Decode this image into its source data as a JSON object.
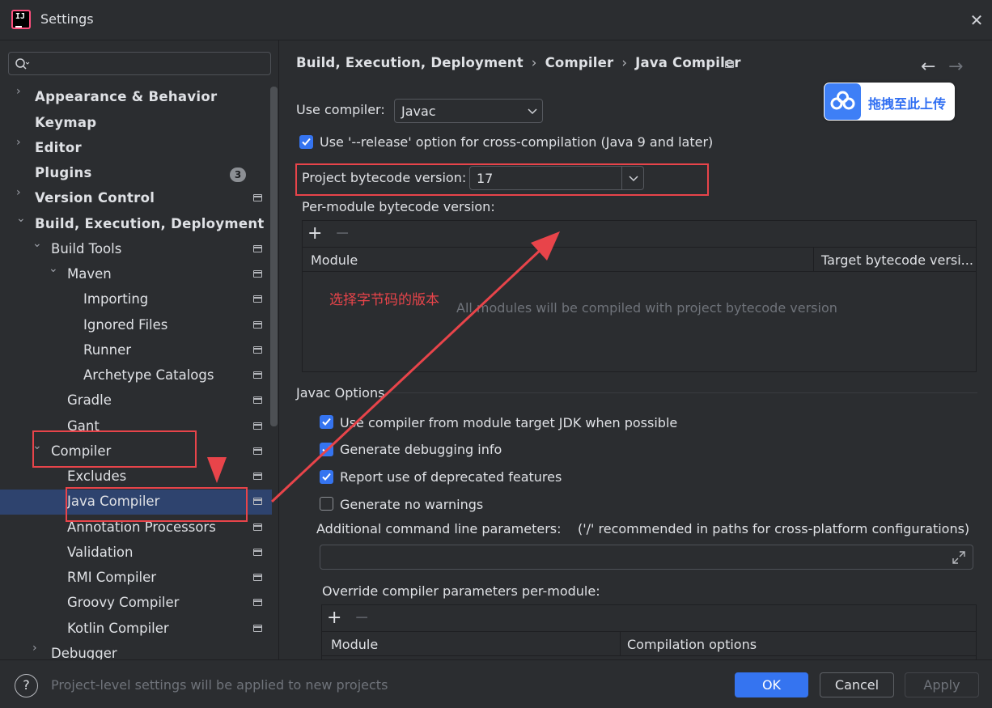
{
  "window": {
    "title": "Settings"
  },
  "sidebar": {
    "search_placeholder": "",
    "items": [
      {
        "label": "Appearance & Behavior"
      },
      {
        "label": "Keymap"
      },
      {
        "label": "Editor"
      },
      {
        "label": "Plugins",
        "badge": "3"
      },
      {
        "label": "Version Control"
      },
      {
        "label": "Build, Execution, Deployment"
      },
      {
        "label": "Build Tools"
      },
      {
        "label": "Maven"
      },
      {
        "label": "Importing"
      },
      {
        "label": "Ignored Files"
      },
      {
        "label": "Runner"
      },
      {
        "label": "Archetype Catalogs"
      },
      {
        "label": "Gradle"
      },
      {
        "label": "Gant"
      },
      {
        "label": "Compiler"
      },
      {
        "label": "Excludes"
      },
      {
        "label": "Java Compiler",
        "selected": true
      },
      {
        "label": "Annotation Processors"
      },
      {
        "label": "Validation"
      },
      {
        "label": "RMI Compiler"
      },
      {
        "label": "Groovy Compiler"
      },
      {
        "label": "Kotlin Compiler"
      },
      {
        "label": "Debugger"
      }
    ]
  },
  "breadcrumb": [
    "Build, Execution, Deployment",
    "Compiler",
    "Java Compiler"
  ],
  "upload_widget": {
    "label": "拖拽至此上传"
  },
  "main": {
    "use_compiler_label": "Use compiler:",
    "use_compiler_value": "Javac",
    "release_option_label": "Use '--release' option for cross-compilation (Java 9 and later)",
    "release_option_checked": true,
    "project_bytecode_label": "Project bytecode version:",
    "project_bytecode_value": "17",
    "per_module_label": "Per-module bytecode version:",
    "per_module_table": {
      "columns": [
        "Module",
        "Target bytecode versi..."
      ],
      "empty_text": "All modules will be compiled with project bytecode version"
    },
    "javac_section_title": "Javac Options",
    "javac_options": [
      {
        "label": "Use compiler from module target JDK when possible",
        "checked": true
      },
      {
        "label": "Generate debugging info",
        "checked": true
      },
      {
        "label": "Report use of deprecated features",
        "checked": true
      },
      {
        "label": "Generate no warnings",
        "checked": false
      }
    ],
    "additional_params_label": "Additional command line parameters:",
    "additional_params_hint": "('/' recommended in paths for cross-platform configurations)",
    "additional_params_value": "",
    "override_label": "Override compiler parameters per-module:",
    "override_table": {
      "columns": [
        "Module",
        "Compilation options"
      ]
    }
  },
  "annotation": {
    "text": "选择字节码的版本",
    "color": "#e8444a"
  },
  "footer": {
    "info_text": "Project-level settings will be applied to new projects",
    "ok_label": "OK",
    "cancel_label": "Cancel",
    "apply_label": "Apply"
  },
  "colors": {
    "accent": "#3574f0",
    "selection": "#2e436e",
    "annotation": "#e8444a"
  }
}
